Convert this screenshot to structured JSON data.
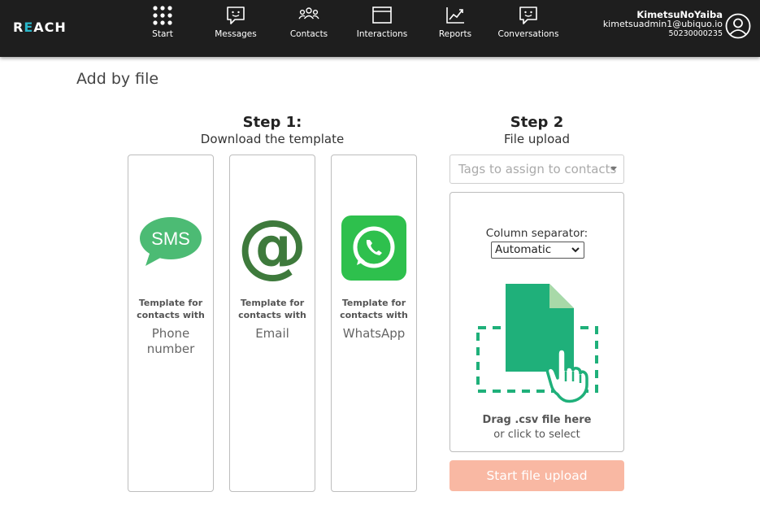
{
  "header": {
    "logo_prefix": "R",
    "logo_accent": "E",
    "logo_suffix": "ACH",
    "nav": [
      {
        "label": "Start",
        "icon": "grid-icon"
      },
      {
        "label": "Messages",
        "icon": "message-icon"
      },
      {
        "label": "Contacts",
        "icon": "contacts-icon"
      },
      {
        "label": "Interactions",
        "icon": "window-icon"
      },
      {
        "label": "Reports",
        "icon": "chart-icon"
      },
      {
        "label": "Conversations",
        "icon": "conversation-icon"
      }
    ],
    "user": {
      "name": "KimetsuNoYaiba",
      "email": "kimetsuadmin1@ubiquo.io",
      "phone": "50230000235"
    }
  },
  "page": {
    "title": "Add by file"
  },
  "step1": {
    "title": "Step 1:",
    "subtitle": "Download the template",
    "templates": [
      {
        "icon_text": "SMS",
        "caption_line1": "Template for",
        "caption_line2": "contacts with",
        "kind_line1": "Phone",
        "kind_line2": "number",
        "icon": "sms-icon"
      },
      {
        "icon_text": "@",
        "caption_line1": "Template for",
        "caption_line2": "contacts with",
        "kind_line1": "Email",
        "kind_line2": "",
        "icon": "at-sign-icon"
      },
      {
        "icon_text": "",
        "caption_line1": "Template for",
        "caption_line2": "contacts with",
        "kind_line1": "WhatsApp",
        "kind_line2": "",
        "icon": "whatsapp-icon"
      }
    ]
  },
  "step2": {
    "title": "Step 2",
    "subtitle": "File upload",
    "tags_placeholder": "Tags to assign to contacts",
    "separator_label": "Column separator:",
    "separator_value": "Automatic",
    "drop_main": "Drag .csv file here",
    "drop_sub": "or click to select",
    "upload_button": "Start file upload"
  },
  "colors": {
    "header_bg": "#1e1e1e",
    "accent": "#29b6c9",
    "sms_green": "#4cbb74",
    "email_green": "#3e7a3c",
    "whatsapp_green": "#2ec04d",
    "file_green": "#1fb07a",
    "upload_button": "#f9b8a3"
  }
}
